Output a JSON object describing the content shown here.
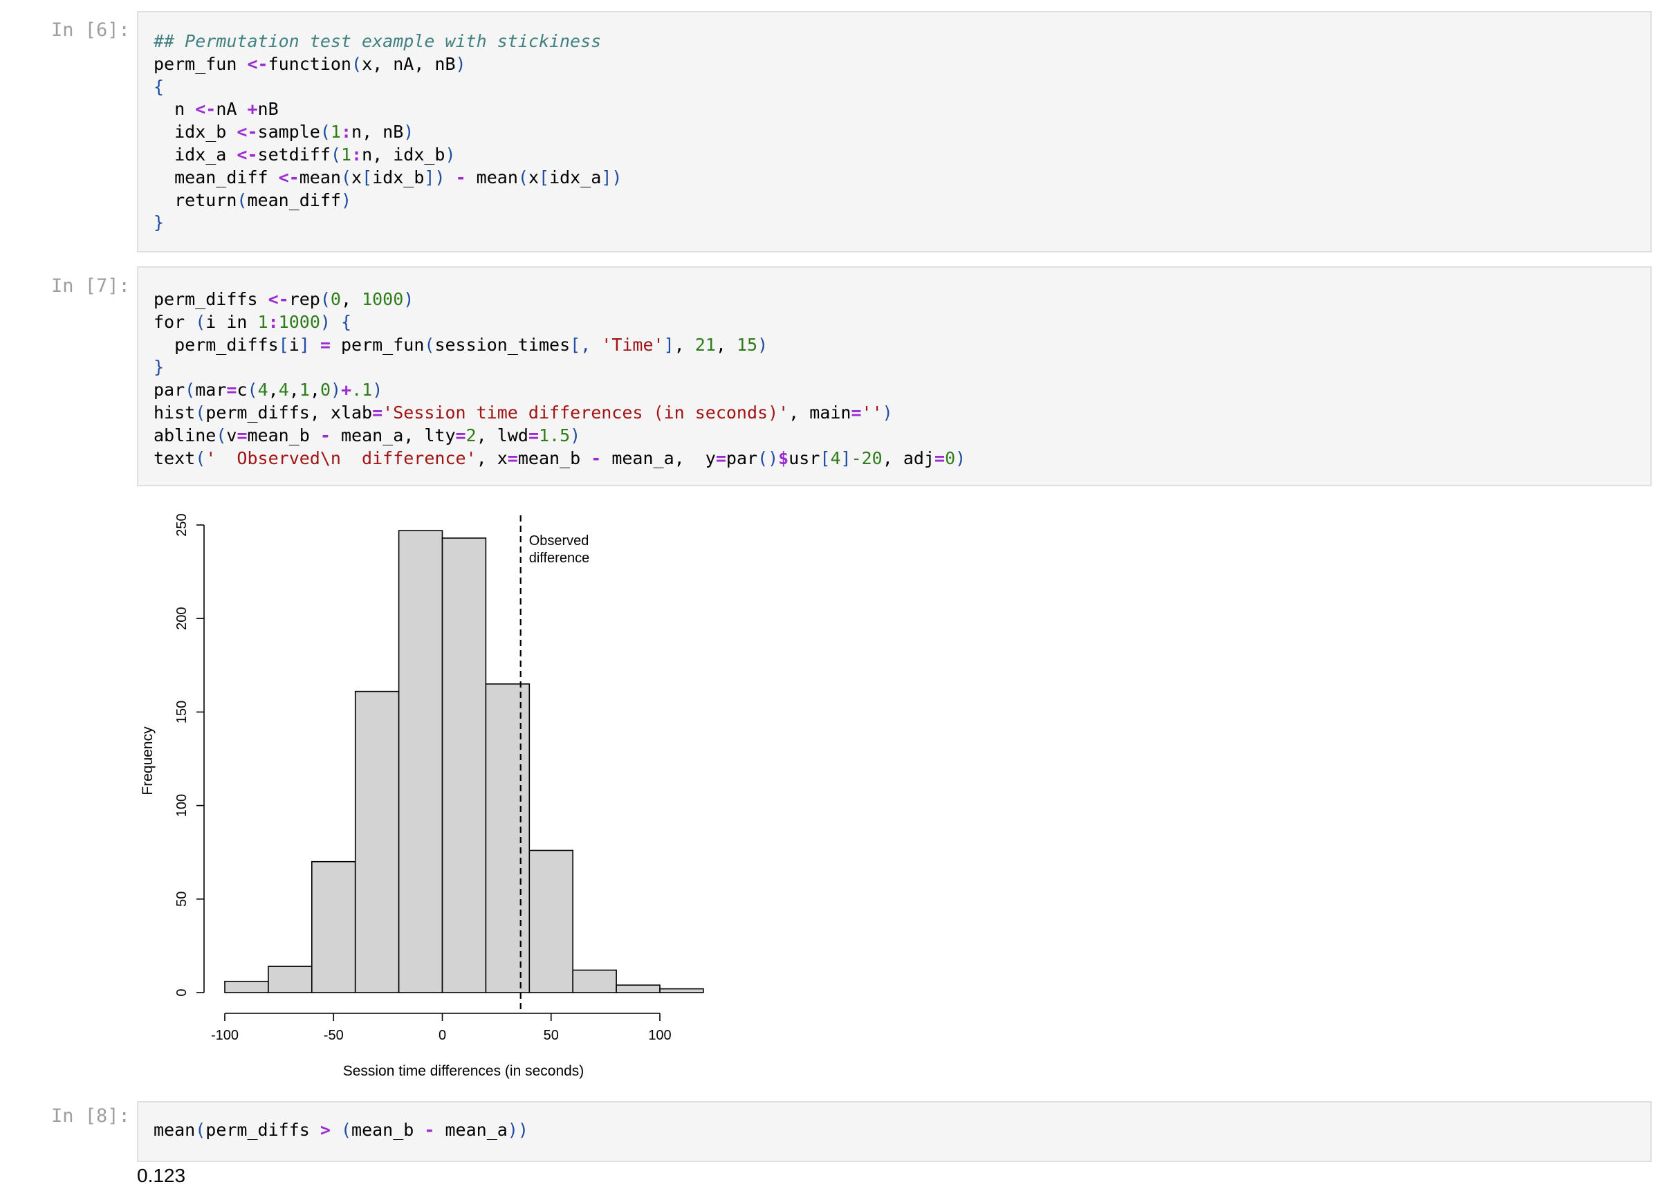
{
  "cells": [
    {
      "prompt": "In [6]:",
      "lines": [
        [
          [
            "cm",
            "## Permutation test example with stickiness"
          ]
        ],
        [
          [
            "",
            "perm_fun "
          ],
          [
            "op",
            "<-"
          ],
          [
            "",
            "function"
          ],
          [
            "pun",
            "("
          ],
          [
            "",
            "x, nA, nB"
          ],
          [
            "pun",
            ")"
          ]
        ],
        [
          [
            "pun",
            "{"
          ]
        ],
        [
          [
            "",
            "  n "
          ],
          [
            "op",
            "<-"
          ],
          [
            "",
            "nA "
          ],
          [
            "op",
            "+"
          ],
          [
            "",
            "nB"
          ]
        ],
        [
          [
            "",
            "  idx_b "
          ],
          [
            "op",
            "<-"
          ],
          [
            "",
            "sample"
          ],
          [
            "pun",
            "("
          ],
          [
            "num",
            "1"
          ],
          [
            "op",
            ":"
          ],
          [
            "",
            "n, nB"
          ],
          [
            "pun",
            ")"
          ]
        ],
        [
          [
            "",
            "  idx_a "
          ],
          [
            "op",
            "<-"
          ],
          [
            "",
            "setdiff"
          ],
          [
            "pun",
            "("
          ],
          [
            "num",
            "1"
          ],
          [
            "op",
            ":"
          ],
          [
            "",
            "n, idx_b"
          ],
          [
            "pun",
            ")"
          ]
        ],
        [
          [
            "",
            "  mean_diff "
          ],
          [
            "op",
            "<-"
          ],
          [
            "",
            "mean"
          ],
          [
            "pun",
            "("
          ],
          [
            "",
            "x"
          ],
          [
            "pun",
            "["
          ],
          [
            "",
            "idx_b"
          ],
          [
            "pun",
            "])"
          ],
          [
            "",
            ""
          ],
          [
            "op",
            " - "
          ],
          [
            "",
            "mean"
          ],
          [
            "pun",
            "("
          ],
          [
            "",
            "x"
          ],
          [
            "pun",
            "["
          ],
          [
            "",
            "idx_a"
          ],
          [
            "pun",
            "])"
          ]
        ],
        [
          [
            "",
            "  return"
          ],
          [
            "pun",
            "("
          ],
          [
            "",
            "mean_diff"
          ],
          [
            "pun",
            ")"
          ]
        ],
        [
          [
            "pun",
            "}"
          ]
        ]
      ]
    },
    {
      "prompt": "In [7]:",
      "lines": [
        [
          [
            "",
            "perm_diffs "
          ],
          [
            "op",
            "<-"
          ],
          [
            "",
            "rep"
          ],
          [
            "pun",
            "("
          ],
          [
            "num",
            "0"
          ],
          [
            "",
            ", "
          ],
          [
            "num",
            "1000"
          ],
          [
            "pun",
            ")"
          ]
        ],
        [
          [
            "",
            "for "
          ],
          [
            "pun",
            "("
          ],
          [
            "",
            "i in "
          ],
          [
            "num",
            "1"
          ],
          [
            "op",
            ":"
          ],
          [
            "num",
            "1000"
          ],
          [
            "pun",
            ") {"
          ]
        ],
        [
          [
            "",
            "  perm_diffs"
          ],
          [
            "pun",
            "["
          ],
          [
            "",
            "i"
          ],
          [
            "pun",
            "]"
          ],
          [
            "op",
            " = "
          ],
          [
            "",
            "perm_fun"
          ],
          [
            "pun",
            "("
          ],
          [
            "",
            "session_times"
          ],
          [
            "pun",
            "[, "
          ],
          [
            "str",
            "'Time'"
          ],
          [
            "pun",
            "]"
          ],
          [
            "",
            ", "
          ],
          [
            "num",
            "21"
          ],
          [
            "",
            ", "
          ],
          [
            "num",
            "15"
          ],
          [
            "pun",
            ")"
          ]
        ],
        [
          [
            "pun",
            "}"
          ]
        ],
        [
          [
            "",
            "par"
          ],
          [
            "pun",
            "("
          ],
          [
            "",
            "mar"
          ],
          [
            "op",
            "="
          ],
          [
            "",
            "c"
          ],
          [
            "pun",
            "("
          ],
          [
            "num",
            "4"
          ],
          [
            "",
            ","
          ],
          [
            "num",
            "4"
          ],
          [
            "",
            ","
          ],
          [
            "num",
            "1"
          ],
          [
            "",
            ","
          ],
          [
            "num",
            "0"
          ],
          [
            "pun",
            ")"
          ],
          [
            "op",
            "+"
          ],
          [
            "num",
            ".1"
          ],
          [
            "pun",
            ")"
          ]
        ],
        [
          [
            "",
            "hist"
          ],
          [
            "pun",
            "("
          ],
          [
            "",
            "perm_diffs, xlab"
          ],
          [
            "op",
            "="
          ],
          [
            "str",
            "'Session time differences (in seconds)'"
          ],
          [
            "",
            ", main"
          ],
          [
            "op",
            "="
          ],
          [
            "str",
            "''"
          ],
          [
            "pun",
            ")"
          ]
        ],
        [
          [
            "",
            "abline"
          ],
          [
            "pun",
            "("
          ],
          [
            "",
            "v"
          ],
          [
            "op",
            "="
          ],
          [
            "",
            "mean_b "
          ],
          [
            "op",
            "-"
          ],
          [
            "",
            ""
          ],
          [
            "",
            " mean_a, lty"
          ],
          [
            "op",
            "="
          ],
          [
            "num",
            "2"
          ],
          [
            "",
            ", lwd"
          ],
          [
            "op",
            "="
          ],
          [
            "num",
            "1.5"
          ],
          [
            "pun",
            ")"
          ]
        ],
        [
          [
            "",
            "text"
          ],
          [
            "pun",
            "("
          ],
          [
            "str",
            "'  Observed\\n  difference'"
          ],
          [
            "",
            ", x"
          ],
          [
            "op",
            "="
          ],
          [
            "",
            "mean_b "
          ],
          [
            "op",
            "-"
          ],
          [
            "",
            ""
          ],
          [
            "",
            " mean_a,  y"
          ],
          [
            "op",
            "="
          ],
          [
            "",
            "par"
          ],
          [
            "pun",
            "()"
          ],
          [
            "op",
            "$"
          ],
          [
            "",
            "usr"
          ],
          [
            "pun",
            "["
          ],
          [
            "num",
            "4"
          ],
          [
            "pun",
            "]"
          ],
          [
            "num",
            "-20"
          ],
          [
            "",
            ", adj"
          ],
          [
            "op",
            "="
          ],
          [
            "num",
            "0"
          ],
          [
            "pun",
            ")"
          ]
        ]
      ]
    },
    {
      "prompt": "In [8]:",
      "lines": [
        [
          [
            "",
            "mean"
          ],
          [
            "pun",
            "("
          ],
          [
            "",
            "perm_diffs "
          ],
          [
            "op",
            ">"
          ],
          [
            "pun",
            " ("
          ],
          [
            "",
            "mean_b "
          ],
          [
            "op",
            "-"
          ],
          [
            "",
            " mean_a"
          ],
          [
            "pun",
            "))"
          ]
        ]
      ]
    }
  ],
  "result_text": "0.123",
  "chart_data": {
    "type": "bar",
    "title": "",
    "xlabel": "Session time differences (in seconds)",
    "ylabel": "Frequency",
    "bins": [
      {
        "from": -100,
        "to": -80,
        "count": 6
      },
      {
        "from": -80,
        "to": -60,
        "count": 14
      },
      {
        "from": -60,
        "to": -40,
        "count": 70
      },
      {
        "from": -40,
        "to": -20,
        "count": 161
      },
      {
        "from": -20,
        "to": 0,
        "count": 247
      },
      {
        "from": 0,
        "to": 20,
        "count": 243
      },
      {
        "from": 20,
        "to": 40,
        "count": 165
      },
      {
        "from": 40,
        "to": 60,
        "count": 76
      },
      {
        "from": 60,
        "to": 80,
        "count": 12
      },
      {
        "from": 80,
        "to": 100,
        "count": 4
      },
      {
        "from": 100,
        "to": 120,
        "count": 2
      }
    ],
    "xticks": [
      -100,
      -50,
      0,
      50,
      100
    ],
    "xtick_labels": [
      "-100",
      "-50",
      "0",
      "50",
      "100"
    ],
    "yticks": [
      0,
      50,
      100,
      150,
      200,
      250
    ],
    "ytick_labels": [
      "0",
      "50",
      "100",
      "150",
      "200",
      "250"
    ],
    "xlim": [
      -100,
      120
    ],
    "ylim": [
      0,
      250
    ],
    "observed_difference": 36,
    "annotation_lines": [
      "Observed",
      "difference"
    ],
    "bar_fill": "#d3d3d3",
    "bar_stroke": "#000000"
  }
}
